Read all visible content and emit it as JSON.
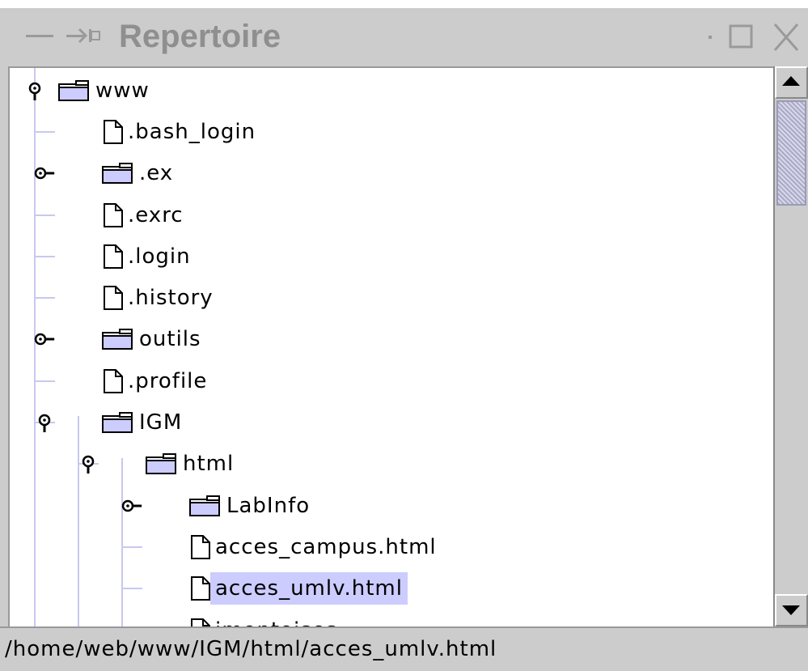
{
  "window": {
    "title": "Repertoire",
    "controls": [
      "minimize-icon",
      "pin-icon",
      "dot-icon",
      "maximize-icon",
      "close-icon"
    ]
  },
  "tree": {
    "nodes": [
      {
        "label": "www",
        "kind": "folder",
        "expanded": true
      },
      {
        "label": ".bash_login",
        "kind": "file"
      },
      {
        "label": ".ex",
        "kind": "folder",
        "expanded": false
      },
      {
        "label": ".exrc",
        "kind": "file"
      },
      {
        "label": ".login",
        "kind": "file"
      },
      {
        "label": ".history",
        "kind": "file"
      },
      {
        "label": "outils",
        "kind": "folder",
        "expanded": false
      },
      {
        "label": ".profile",
        "kind": "file"
      },
      {
        "label": "IGM",
        "kind": "folder",
        "expanded": true
      },
      {
        "label": "html",
        "kind": "folder",
        "expanded": true
      },
      {
        "label": "LabInfo",
        "kind": "folder",
        "expanded": false
      },
      {
        "label": "acces_campus.html",
        "kind": "file"
      },
      {
        "label": "acces_umlv.html",
        "kind": "file",
        "selected": true
      },
      {
        "label": "imontoises",
        "kind": "file"
      }
    ]
  },
  "status": {
    "path": "/home/web/www/IGM/html/acces_umlv.html"
  },
  "colors": {
    "selection": "#ccccff",
    "folder": "#ccccff",
    "tree_lines": "#c8c8f0",
    "chrome": "#cccccc"
  }
}
